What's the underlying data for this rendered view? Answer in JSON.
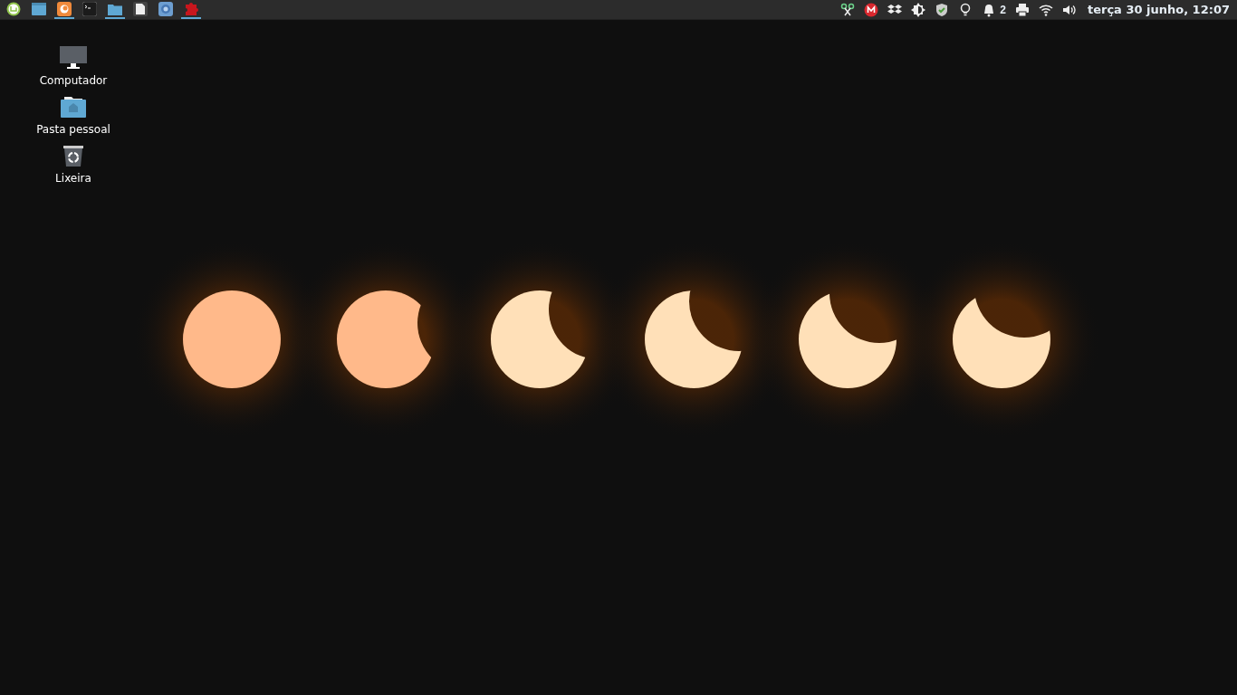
{
  "panel": {
    "launchers": [
      {
        "kind": "menu",
        "running": false
      },
      {
        "kind": "desktop",
        "running": false
      },
      {
        "kind": "browser",
        "running": true
      },
      {
        "kind": "terminal",
        "running": false
      },
      {
        "kind": "files",
        "running": true
      },
      {
        "kind": "editor",
        "running": false
      },
      {
        "kind": "chromium",
        "running": false
      },
      {
        "kind": "puzzle",
        "running": true
      }
    ],
    "tray": [
      {
        "kind": "scissors"
      },
      {
        "kind": "mega"
      },
      {
        "kind": "dropbox"
      },
      {
        "kind": "brightness"
      },
      {
        "kind": "shield"
      },
      {
        "kind": "bulb"
      },
      {
        "kind": "bell",
        "count": "2"
      },
      {
        "kind": "printer"
      },
      {
        "kind": "wifi"
      },
      {
        "kind": "volume"
      }
    ],
    "clock": "terça 30 junho, 12:07"
  },
  "desktop_icons": [
    {
      "kind": "computer",
      "label": "Computador"
    },
    {
      "kind": "home",
      "label": "Pasta pessoal"
    },
    {
      "kind": "trash",
      "label": "Lixeira"
    }
  ]
}
